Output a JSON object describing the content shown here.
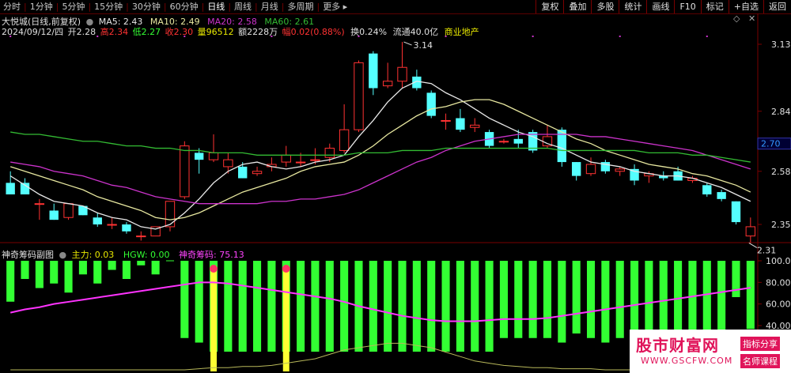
{
  "toolbar": {
    "periods": [
      "分时",
      "1分钟",
      "5分钟",
      "15分钟",
      "30分钟",
      "60分钟",
      "日线",
      "周线",
      "月线",
      "多周期",
      "更多"
    ],
    "active_index": 6,
    "right_buttons": [
      "复权",
      "叠加",
      "多股",
      "统计",
      "画线",
      "F10",
      "标记",
      "+自选",
      "返回"
    ]
  },
  "header": {
    "stock": "大悦城(日线,前复权)",
    "ma5": "MA5: 2.43",
    "ma10": "MA10: 2.49",
    "ma20": "MA20: 2.58",
    "ma60": "MA60: 2.61",
    "date": "2024/09/12/四",
    "open_l": "开",
    "open": "2.28",
    "high_l": "高",
    "high": "2.34",
    "low_l": "低",
    "low": "2.27",
    "close_l": "收",
    "close": "2.30",
    "vol_l": "量",
    "vol": "96512",
    "amt_l": "额",
    "amt": "2228万",
    "chg_l": "幅",
    "chg": "0.02(0.88%)",
    "turn": "换0.24%",
    "float": "流通40.0亿",
    "sector": "商业地产"
  },
  "price_axis": {
    "ticks": [
      "3.13",
      "2.84",
      "2.58",
      "2.35"
    ],
    "current": "2.70"
  },
  "annotations": {
    "high": "3.14",
    "low": "2.31"
  },
  "sub": {
    "title": "神奇筹码副图",
    "main": "主力: 0.03",
    "hgw": "HGW: 0.00",
    "chip": "神奇筹码: 75.13",
    "ticks": [
      "100.0",
      "80.00",
      "60.00",
      "40.00"
    ]
  },
  "watermark": {
    "site": "股市财富网",
    "url": "WWW.GSCFW.COM",
    "tag1": "指标分享",
    "tag2": "名师课程"
  },
  "colors": {
    "up": "#ff3232",
    "down": "#54ffff",
    "ma5": "#e8e8e8",
    "ma10": "#e8e8a0",
    "ma20": "#cc33cc",
    "ma60": "#33bb33",
    "bar": "#33ff33",
    "yellow": "#ffff33"
  },
  "chart_data": {
    "type": "candlestick",
    "price_range": [
      2.2,
      3.2
    ],
    "candles": [
      {
        "o": 2.53,
        "h": 2.58,
        "l": 2.48,
        "c": 2.48
      },
      {
        "o": 2.53,
        "h": 2.55,
        "l": 2.48,
        "c": 2.48
      },
      {
        "o": 2.44,
        "h": 2.46,
        "l": 2.37,
        "c": 2.44
      },
      {
        "o": 2.41,
        "h": 2.44,
        "l": 2.37,
        "c": 2.37
      },
      {
        "o": 2.38,
        "h": 2.44,
        "l": 2.37,
        "c": 2.44
      },
      {
        "o": 2.43,
        "h": 2.43,
        "l": 2.39,
        "c": 2.39
      },
      {
        "o": 2.38,
        "h": 2.4,
        "l": 2.34,
        "c": 2.35
      },
      {
        "o": 2.35,
        "h": 2.38,
        "l": 2.33,
        "c": 2.35
      },
      {
        "o": 2.35,
        "h": 2.36,
        "l": 2.31,
        "c": 2.32
      },
      {
        "o": 2.3,
        "h": 2.32,
        "l": 2.28,
        "c": 2.3
      },
      {
        "o": 2.3,
        "h": 2.34,
        "l": 2.3,
        "c": 2.34
      },
      {
        "o": 2.34,
        "h": 2.45,
        "l": 2.32,
        "c": 2.45
      },
      {
        "o": 2.47,
        "h": 2.71,
        "l": 2.46,
        "c": 2.69
      },
      {
        "o": 2.66,
        "h": 2.68,
        "l": 2.57,
        "c": 2.63
      },
      {
        "o": 2.63,
        "h": 2.74,
        "l": 2.62,
        "c": 2.66
      },
      {
        "o": 2.6,
        "h": 2.66,
        "l": 2.57,
        "c": 2.63
      },
      {
        "o": 2.6,
        "h": 2.62,
        "l": 2.55,
        "c": 2.55
      },
      {
        "o": 2.57,
        "h": 2.6,
        "l": 2.56,
        "c": 2.58
      },
      {
        "o": 2.6,
        "h": 2.64,
        "l": 2.58,
        "c": 2.61
      },
      {
        "o": 2.62,
        "h": 2.69,
        "l": 2.6,
        "c": 2.65
      },
      {
        "o": 2.62,
        "h": 2.66,
        "l": 2.6,
        "c": 2.62
      },
      {
        "o": 2.63,
        "h": 2.68,
        "l": 2.61,
        "c": 2.63
      },
      {
        "o": 2.64,
        "h": 2.7,
        "l": 2.62,
        "c": 2.68
      },
      {
        "o": 2.67,
        "h": 2.87,
        "l": 2.66,
        "c": 2.76
      },
      {
        "o": 2.76,
        "h": 3.06,
        "l": 2.75,
        "c": 3.05
      },
      {
        "o": 3.09,
        "h": 3.1,
        "l": 2.91,
        "c": 2.94
      },
      {
        "o": 2.95,
        "h": 3.05,
        "l": 2.94,
        "c": 2.97
      },
      {
        "o": 2.97,
        "h": 3.14,
        "l": 2.94,
        "c": 3.03
      },
      {
        "o": 2.99,
        "h": 3.02,
        "l": 2.93,
        "c": 2.94
      },
      {
        "o": 2.92,
        "h": 2.93,
        "l": 2.81,
        "c": 2.82
      },
      {
        "o": 2.8,
        "h": 2.83,
        "l": 2.76,
        "c": 2.8
      },
      {
        "o": 2.81,
        "h": 2.85,
        "l": 2.75,
        "c": 2.76
      },
      {
        "o": 2.77,
        "h": 2.81,
        "l": 2.75,
        "c": 2.78
      },
      {
        "o": 2.75,
        "h": 2.76,
        "l": 2.68,
        "c": 2.69
      },
      {
        "o": 2.71,
        "h": 2.72,
        "l": 2.7,
        "c": 2.71
      },
      {
        "o": 2.72,
        "h": 2.76,
        "l": 2.68,
        "c": 2.7
      },
      {
        "o": 2.75,
        "h": 2.76,
        "l": 2.66,
        "c": 2.67
      },
      {
        "o": 2.69,
        "h": 2.78,
        "l": 2.68,
        "c": 2.73
      },
      {
        "o": 2.76,
        "h": 2.77,
        "l": 2.6,
        "c": 2.62
      },
      {
        "o": 2.62,
        "h": 2.62,
        "l": 2.54,
        "c": 2.56
      },
      {
        "o": 2.57,
        "h": 2.64,
        "l": 2.56,
        "c": 2.61
      },
      {
        "o": 2.62,
        "h": 2.63,
        "l": 2.57,
        "c": 2.58
      },
      {
        "o": 2.58,
        "h": 2.6,
        "l": 2.56,
        "c": 2.59
      },
      {
        "o": 2.59,
        "h": 2.61,
        "l": 2.52,
        "c": 2.54
      },
      {
        "o": 2.56,
        "h": 2.58,
        "l": 2.53,
        "c": 2.57
      },
      {
        "o": 2.56,
        "h": 2.58,
        "l": 2.54,
        "c": 2.55
      },
      {
        "o": 2.58,
        "h": 2.6,
        "l": 2.54,
        "c": 2.54
      },
      {
        "o": 2.54,
        "h": 2.56,
        "l": 2.53,
        "c": 2.55
      },
      {
        "o": 2.52,
        "h": 2.53,
        "l": 2.47,
        "c": 2.48
      },
      {
        "o": 2.49,
        "h": 2.5,
        "l": 2.45,
        "c": 2.46
      },
      {
        "o": 2.45,
        "h": 2.45,
        "l": 2.35,
        "c": 2.36
      },
      {
        "o": 2.3,
        "h": 2.38,
        "l": 2.27,
        "c": 2.34
      }
    ],
    "ma5": [
      2.56,
      2.52,
      2.48,
      2.45,
      2.44,
      2.43,
      2.4,
      2.38,
      2.37,
      2.34,
      2.33,
      2.35,
      2.4,
      2.46,
      2.53,
      2.58,
      2.61,
      2.62,
      2.6,
      2.59,
      2.6,
      2.62,
      2.63,
      2.65,
      2.73,
      2.8,
      2.88,
      2.94,
      2.97,
      2.96,
      2.92,
      2.89,
      2.85,
      2.81,
      2.78,
      2.75,
      2.73,
      2.7,
      2.68,
      2.65,
      2.62,
      2.61,
      2.6,
      2.58,
      2.57,
      2.56,
      2.56,
      2.55,
      2.53,
      2.51,
      2.48,
      2.45
    ],
    "ma10": [
      2.6,
      2.58,
      2.56,
      2.54,
      2.52,
      2.5,
      2.47,
      2.45,
      2.43,
      2.41,
      2.38,
      2.37,
      2.38,
      2.4,
      2.43,
      2.46,
      2.49,
      2.51,
      2.53,
      2.55,
      2.58,
      2.6,
      2.61,
      2.62,
      2.65,
      2.69,
      2.74,
      2.78,
      2.82,
      2.85,
      2.86,
      2.88,
      2.89,
      2.89,
      2.87,
      2.84,
      2.81,
      2.78,
      2.75,
      2.72,
      2.7,
      2.67,
      2.65,
      2.63,
      2.61,
      2.6,
      2.59,
      2.57,
      2.56,
      2.54,
      2.52,
      2.49
    ],
    "ma20": [
      2.62,
      2.61,
      2.6,
      2.58,
      2.57,
      2.56,
      2.54,
      2.52,
      2.51,
      2.49,
      2.47,
      2.46,
      2.45,
      2.44,
      2.44,
      2.44,
      2.44,
      2.44,
      2.45,
      2.45,
      2.46,
      2.46,
      2.47,
      2.48,
      2.5,
      2.53,
      2.56,
      2.59,
      2.62,
      2.64,
      2.67,
      2.69,
      2.71,
      2.72,
      2.73,
      2.74,
      2.74,
      2.74,
      2.74,
      2.74,
      2.73,
      2.73,
      2.72,
      2.71,
      2.7,
      2.69,
      2.68,
      2.67,
      2.65,
      2.63,
      2.61,
      2.59
    ],
    "ma60": [
      2.75,
      2.74,
      2.74,
      2.73,
      2.72,
      2.71,
      2.71,
      2.7,
      2.69,
      2.69,
      2.68,
      2.68,
      2.67,
      2.67,
      2.66,
      2.66,
      2.66,
      2.65,
      2.65,
      2.65,
      2.65,
      2.65,
      2.65,
      2.65,
      2.66,
      2.66,
      2.66,
      2.67,
      2.67,
      2.67,
      2.68,
      2.68,
      2.68,
      2.68,
      2.68,
      2.68,
      2.68,
      2.68,
      2.67,
      2.67,
      2.67,
      2.67,
      2.67,
      2.67,
      2.66,
      2.66,
      2.66,
      2.65,
      2.65,
      2.64,
      2.63,
      2.62
    ],
    "sub_range": [
      30,
      105
    ],
    "green_bars": [
      45,
      20,
      30,
      25,
      35,
      15,
      25,
      10,
      20,
      5,
      15,
      0,
      85,
      90,
      100,
      100,
      100,
      100,
      100,
      100,
      100,
      100,
      100,
      100,
      100,
      100,
      100,
      100,
      100,
      100,
      100,
      100,
      100,
      100,
      85,
      85,
      85,
      85,
      90,
      80,
      85,
      90,
      85,
      85,
      90,
      90,
      80,
      80,
      80,
      85,
      40,
      75
    ],
    "yellow_bars": [
      14,
      19
    ],
    "magenta_line": [
      52,
      55,
      57,
      60,
      62,
      64,
      66,
      68,
      70,
      72,
      74,
      76,
      78,
      80,
      80,
      79,
      77,
      75,
      73,
      71,
      69,
      67,
      65,
      62,
      58,
      55,
      52,
      49,
      47,
      45,
      44,
      44,
      44,
      45,
      46,
      46,
      46,
      47,
      49,
      51,
      53,
      55,
      57,
      59,
      61,
      63,
      65,
      67,
      69,
      71,
      73,
      75
    ],
    "yellow_line": [
      0,
      0,
      0,
      0,
      0,
      0,
      0,
      0,
      0,
      0,
      0,
      0,
      0,
      1,
      2,
      2,
      3,
      3,
      4,
      6,
      8,
      10,
      14,
      18,
      20,
      22,
      24,
      24,
      22,
      20,
      16,
      12,
      8,
      6,
      4,
      3,
      2,
      2,
      1,
      1,
      1,
      0,
      0,
      0,
      0,
      0,
      0,
      0,
      0,
      0,
      0,
      0
    ]
  }
}
